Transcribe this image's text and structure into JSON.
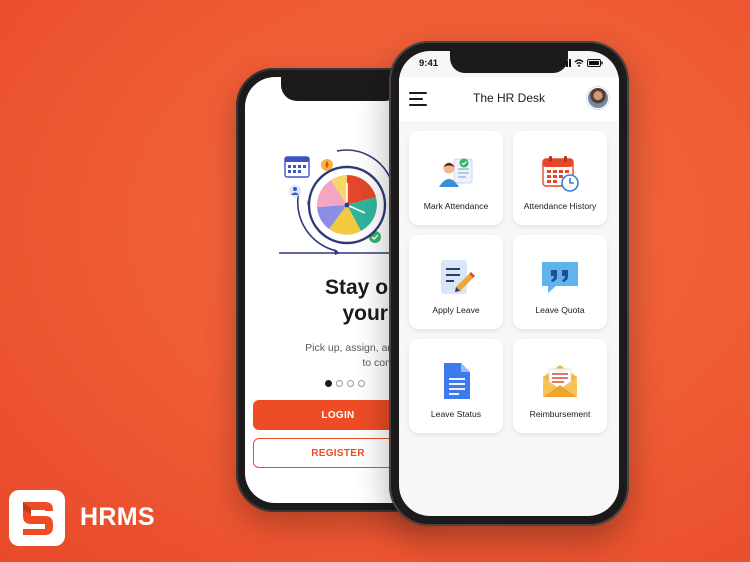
{
  "colors": {
    "background": "#ef5a34",
    "accent": "#ed4c25",
    "text": "#1b1b1f"
  },
  "brand": {
    "name": "HRMS",
    "logo_icon": "brand-s-logo-icon"
  },
  "onboarding": {
    "title": "Stay on top of\nyour tasks",
    "subtitle": "Pick up, assign, and see tasks through\nto completion.",
    "pages_total": 4,
    "page_active": 1,
    "login_label": "LOGIN",
    "register_label": "REGISTER"
  },
  "dashboard": {
    "status_time": "9:41",
    "title": "The HR Desk",
    "tiles": [
      {
        "label": "Mark Attendance",
        "icon": "mark-attendance-icon"
      },
      {
        "label": "Attendance History",
        "icon": "calendar-clock-icon"
      },
      {
        "label": "Apply Leave",
        "icon": "edit-document-icon"
      },
      {
        "label": "Leave Quota",
        "icon": "quote-bubble-icon"
      },
      {
        "label": "Leave Status",
        "icon": "document-icon"
      },
      {
        "label": "Reimbursement",
        "icon": "envelope-icon"
      }
    ]
  }
}
